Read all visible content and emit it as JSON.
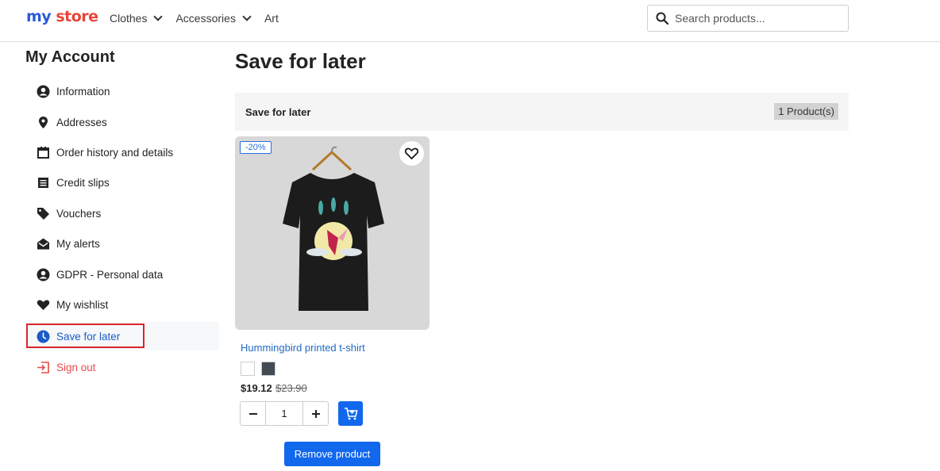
{
  "header": {
    "logo": {
      "part1": "my",
      "part2": "store"
    },
    "nav": [
      {
        "label": "Clothes",
        "has_dropdown": true
      },
      {
        "label": "Accessories",
        "has_dropdown": true
      },
      {
        "label": "Art",
        "has_dropdown": false
      }
    ],
    "search": {
      "placeholder": "Search products...",
      "value": ""
    }
  },
  "sidebar": {
    "title": "My Account",
    "items": [
      {
        "label": "Information",
        "icon": "user-circle-icon"
      },
      {
        "label": "Addresses",
        "icon": "location-pin-icon"
      },
      {
        "label": "Order history and details",
        "icon": "calendar-icon"
      },
      {
        "label": "Credit slips",
        "icon": "document-list-icon"
      },
      {
        "label": "Vouchers",
        "icon": "tag-icon"
      },
      {
        "label": "My alerts",
        "icon": "envelope-open-icon"
      },
      {
        "label": "GDPR - Personal data",
        "icon": "user-circle-icon"
      },
      {
        "label": "My wishlist",
        "icon": "heart-icon"
      },
      {
        "label": "Save for later",
        "icon": "clock-icon",
        "active": true
      },
      {
        "label": "Sign out",
        "icon": "sign-out-icon"
      }
    ]
  },
  "main": {
    "title": "Save for later",
    "bar_title": "Save for later",
    "count": "1 Product(s)",
    "product": {
      "discount": "-20%",
      "name": "Hummingbird printed t-shirt",
      "colors": [
        "#ffffff",
        "#434a54"
      ],
      "price": "$19.12",
      "old_price": "$23.90",
      "quantity": "1",
      "remove_label": "Remove product"
    }
  },
  "colors": {
    "accent": "#1268ec",
    "link": "#1f69c7",
    "signout": "#e54b4b",
    "highlight_border": "#d9262c"
  }
}
